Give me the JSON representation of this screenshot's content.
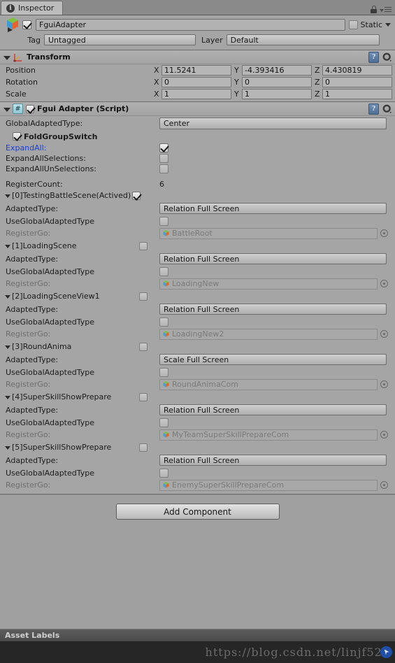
{
  "tab": {
    "label": "Inspector",
    "icon": "info-icon"
  },
  "toolbar": {
    "lock_icon": "lock-icon",
    "menu_icon": "hamburger-menu-icon"
  },
  "gameobject": {
    "icon": "gameobject-cube-icon",
    "enabled": true,
    "name": "FguiAdapter",
    "static_label": "Static",
    "static_checked": false,
    "tag_label": "Tag",
    "tag_value": "Untagged",
    "layer_label": "Layer",
    "layer_value": "Default"
  },
  "transform": {
    "title": "Transform",
    "icon": "transform-axis-icon",
    "help_icon": "help-book-icon",
    "gear_icon": "gear-icon",
    "rows": [
      {
        "label": "Position",
        "x": "11.5241",
        "y": "-4.393416",
        "z": "4.430819"
      },
      {
        "label": "Rotation",
        "x": "0",
        "y": "0",
        "z": "0"
      },
      {
        "label": "Scale",
        "x": "1",
        "y": "1",
        "z": "1"
      }
    ],
    "axis_labels": [
      "X",
      "Y",
      "Z"
    ]
  },
  "script_component": {
    "title": "Fgui Adapter (Script)",
    "icon": "csharp-script-icon",
    "enabled": true,
    "help_icon": "help-book-icon",
    "gear_icon": "gear-icon",
    "global_adapted_type_label": "GlobalAdaptedType:",
    "global_adapted_type_value": "Center",
    "fold_group_switch_label": "FoldGroupSwitch",
    "fold_group_switch_checked": true,
    "expand_all_label": "ExpandAll:",
    "expand_all_checked": true,
    "expand_all_selections_label": "ExpandAllSelections:",
    "expand_all_selections_checked": false,
    "expand_all_unselections_label": "ExpandAllUnSelections:",
    "expand_all_unselections_checked": false,
    "register_count_label": "RegisterCount:",
    "register_count_value": "6",
    "field_labels": {
      "adapted_type": "AdaptedType:",
      "use_global_adapted_type": "UseGlobalAdaptedType",
      "register_go": "RegisterGo:"
    },
    "entries": [
      {
        "name": "[0]TestingBattleScene(Actived)",
        "checked": true,
        "adapted_type": "Relation Full Screen",
        "use_global_adapted_type": false,
        "register_go": "BattleRoot"
      },
      {
        "name": "[1]LoadingScene",
        "checked": false,
        "adapted_type": "Relation Full Screen",
        "use_global_adapted_type": false,
        "register_go": "LoadingNew"
      },
      {
        "name": "[2]LoadingSceneView1",
        "checked": false,
        "adapted_type": "Relation Full Screen",
        "use_global_adapted_type": false,
        "register_go": "LoadingNew2"
      },
      {
        "name": "[3]RoundAnima",
        "checked": false,
        "adapted_type": "Scale Full Screen",
        "use_global_adapted_type": false,
        "register_go": "RoundAnimaCom"
      },
      {
        "name": "[4]SuperSkillShowPrepare",
        "checked": false,
        "adapted_type": "Relation Full Screen",
        "use_global_adapted_type": false,
        "register_go": "MyTeamSuperSkillPrepareCom"
      },
      {
        "name": "[5]SuperSkillShowPrepare",
        "checked": false,
        "adapted_type": "Relation Full Screen",
        "use_global_adapted_type": false,
        "register_go": "EnemySuperSkillPrepareCom"
      }
    ]
  },
  "add_component": {
    "label": "Add Component"
  },
  "footer": {
    "asset_labels": "Asset Labels",
    "watermark": "https://blog.csdn.net/linjf520"
  },
  "colors": {
    "panel_bg": "#a5a5a5",
    "window_bg": "#a0a0a0",
    "link_blue": "#1b3fdd",
    "dim_text": "#6f6f6f",
    "footer_dark": "#262626"
  }
}
